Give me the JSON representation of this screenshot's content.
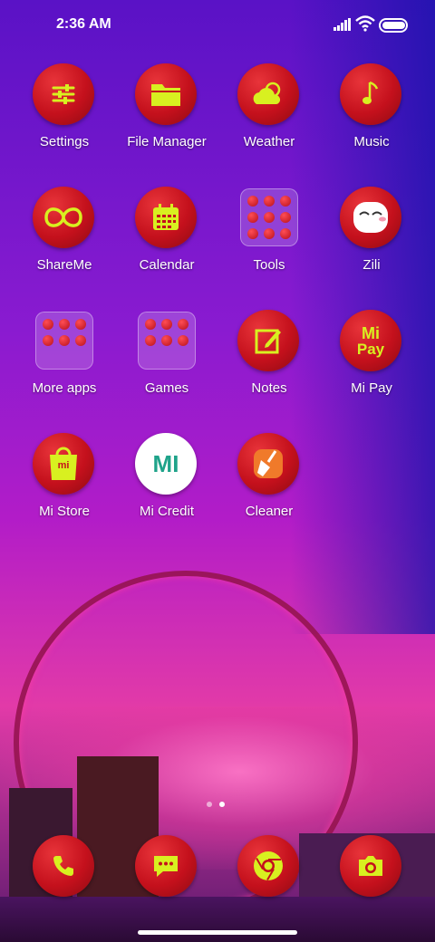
{
  "status_bar": {
    "time": "2:36 AM"
  },
  "apps": [
    {
      "label": "Settings",
      "icon": "sliders-icon"
    },
    {
      "label": "File Manager",
      "icon": "folder-icon"
    },
    {
      "label": "Weather",
      "icon": "cloud-sun-icon"
    },
    {
      "label": "Music",
      "icon": "music-note-icon"
    },
    {
      "label": "ShareMe",
      "icon": "infinity-icon"
    },
    {
      "label": "Calendar",
      "icon": "calendar-icon"
    },
    {
      "label": "Tools",
      "icon": "folder-tools-icon"
    },
    {
      "label": "Zili",
      "icon": "zili-face-icon"
    },
    {
      "label": "More apps",
      "icon": "folder-more-apps-icon"
    },
    {
      "label": "Games",
      "icon": "folder-games-icon"
    },
    {
      "label": "Notes",
      "icon": "note-pencil-icon"
    },
    {
      "label": "Mi Pay",
      "icon": "mi-pay-icon"
    },
    {
      "label": "Mi Store",
      "icon": "shopping-bag-icon"
    },
    {
      "label": "Mi Credit",
      "icon": "mi-credit-icon"
    },
    {
      "label": "Cleaner",
      "icon": "broom-icon"
    }
  ],
  "dock": [
    {
      "name": "phone",
      "icon": "phone-icon"
    },
    {
      "name": "messages",
      "icon": "chat-bubble-icon"
    },
    {
      "name": "browser",
      "icon": "chrome-icon"
    },
    {
      "name": "camera",
      "icon": "camera-icon"
    }
  ],
  "icon_texts": {
    "mi_pay_top": "Mi",
    "mi_pay_bottom": "Pay",
    "mi_credit": "MI",
    "mi_store": "mi"
  },
  "page_indicator": {
    "pages": 2,
    "active": 2
  },
  "colors": {
    "icon_red": "#c4101c",
    "glyph_yellow": "#d8f020",
    "label": "#ffffff"
  }
}
